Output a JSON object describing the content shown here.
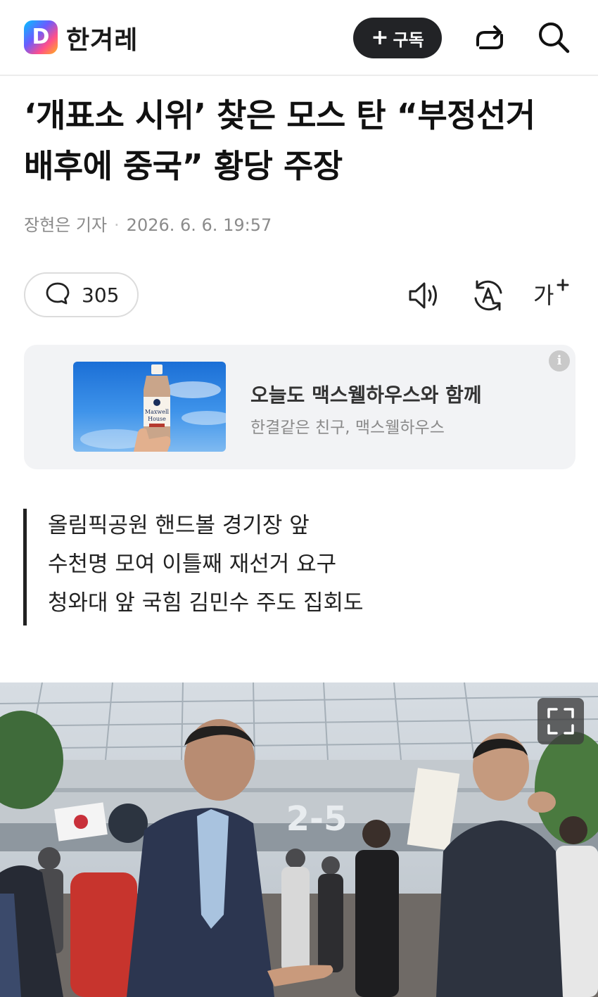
{
  "header": {
    "logo_letter": "D",
    "brand": "한겨레",
    "subscribe_plus": "+",
    "subscribe_label": "구독"
  },
  "article": {
    "title_line1": "‘개표소 시위’ 찾은 모스 탄 “부정선거",
    "title_line2": "배후에 중국” 황당 주장",
    "author": "장현은 기자",
    "separator": "·",
    "datetime": "2026. 6. 6. 19:57",
    "comment_count": "305",
    "font_size_label": "가",
    "summary": [
      "올림픽공원 핸드볼 경기장 앞",
      "수천명 모여 이틀째 재선거 요구",
      "청와대 앞 국힘 김민수 주도 집회도"
    ]
  },
  "ad": {
    "title": "오늘도 맥스웰하우스와 함께",
    "subtitle": "한결같은 친구, 맥스웰하우스",
    "info_glyph": "i",
    "product_label_1": "Maxwell",
    "product_label_2": "House"
  },
  "photo": {
    "sign_text": "2-5"
  },
  "icons": {
    "share": "share-icon",
    "search": "search-icon",
    "comment": "comment-icon",
    "speaker": "speaker-icon",
    "translate": "translate-icon",
    "fullscreen": "fullscreen-icon"
  },
  "colors": {
    "subscribe_bg": "#222326",
    "summary_bar": "#222222",
    "ad_bg": "#f2f3f5",
    "byline": "#8b8b8b"
  }
}
